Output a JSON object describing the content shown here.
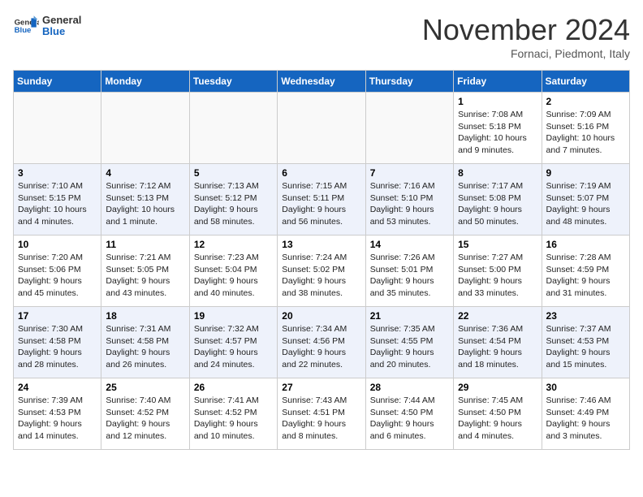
{
  "header": {
    "logo_line1": "General",
    "logo_line2": "Blue",
    "month_title": "November 2024",
    "subtitle": "Fornaci, Piedmont, Italy"
  },
  "weekdays": [
    "Sunday",
    "Monday",
    "Tuesday",
    "Wednesday",
    "Thursday",
    "Friday",
    "Saturday"
  ],
  "weeks": [
    [
      {
        "day": "",
        "info": ""
      },
      {
        "day": "",
        "info": ""
      },
      {
        "day": "",
        "info": ""
      },
      {
        "day": "",
        "info": ""
      },
      {
        "day": "",
        "info": ""
      },
      {
        "day": "1",
        "info": "Sunrise: 7:08 AM\nSunset: 5:18 PM\nDaylight: 10 hours and 9 minutes."
      },
      {
        "day": "2",
        "info": "Sunrise: 7:09 AM\nSunset: 5:16 PM\nDaylight: 10 hours and 7 minutes."
      }
    ],
    [
      {
        "day": "3",
        "info": "Sunrise: 7:10 AM\nSunset: 5:15 PM\nDaylight: 10 hours and 4 minutes."
      },
      {
        "day": "4",
        "info": "Sunrise: 7:12 AM\nSunset: 5:13 PM\nDaylight: 10 hours and 1 minute."
      },
      {
        "day": "5",
        "info": "Sunrise: 7:13 AM\nSunset: 5:12 PM\nDaylight: 9 hours and 58 minutes."
      },
      {
        "day": "6",
        "info": "Sunrise: 7:15 AM\nSunset: 5:11 PM\nDaylight: 9 hours and 56 minutes."
      },
      {
        "day": "7",
        "info": "Sunrise: 7:16 AM\nSunset: 5:10 PM\nDaylight: 9 hours and 53 minutes."
      },
      {
        "day": "8",
        "info": "Sunrise: 7:17 AM\nSunset: 5:08 PM\nDaylight: 9 hours and 50 minutes."
      },
      {
        "day": "9",
        "info": "Sunrise: 7:19 AM\nSunset: 5:07 PM\nDaylight: 9 hours and 48 minutes."
      }
    ],
    [
      {
        "day": "10",
        "info": "Sunrise: 7:20 AM\nSunset: 5:06 PM\nDaylight: 9 hours and 45 minutes."
      },
      {
        "day": "11",
        "info": "Sunrise: 7:21 AM\nSunset: 5:05 PM\nDaylight: 9 hours and 43 minutes."
      },
      {
        "day": "12",
        "info": "Sunrise: 7:23 AM\nSunset: 5:04 PM\nDaylight: 9 hours and 40 minutes."
      },
      {
        "day": "13",
        "info": "Sunrise: 7:24 AM\nSunset: 5:02 PM\nDaylight: 9 hours and 38 minutes."
      },
      {
        "day": "14",
        "info": "Sunrise: 7:26 AM\nSunset: 5:01 PM\nDaylight: 9 hours and 35 minutes."
      },
      {
        "day": "15",
        "info": "Sunrise: 7:27 AM\nSunset: 5:00 PM\nDaylight: 9 hours and 33 minutes."
      },
      {
        "day": "16",
        "info": "Sunrise: 7:28 AM\nSunset: 4:59 PM\nDaylight: 9 hours and 31 minutes."
      }
    ],
    [
      {
        "day": "17",
        "info": "Sunrise: 7:30 AM\nSunset: 4:58 PM\nDaylight: 9 hours and 28 minutes."
      },
      {
        "day": "18",
        "info": "Sunrise: 7:31 AM\nSunset: 4:58 PM\nDaylight: 9 hours and 26 minutes."
      },
      {
        "day": "19",
        "info": "Sunrise: 7:32 AM\nSunset: 4:57 PM\nDaylight: 9 hours and 24 minutes."
      },
      {
        "day": "20",
        "info": "Sunrise: 7:34 AM\nSunset: 4:56 PM\nDaylight: 9 hours and 22 minutes."
      },
      {
        "day": "21",
        "info": "Sunrise: 7:35 AM\nSunset: 4:55 PM\nDaylight: 9 hours and 20 minutes."
      },
      {
        "day": "22",
        "info": "Sunrise: 7:36 AM\nSunset: 4:54 PM\nDaylight: 9 hours and 18 minutes."
      },
      {
        "day": "23",
        "info": "Sunrise: 7:37 AM\nSunset: 4:53 PM\nDaylight: 9 hours and 15 minutes."
      }
    ],
    [
      {
        "day": "24",
        "info": "Sunrise: 7:39 AM\nSunset: 4:53 PM\nDaylight: 9 hours and 14 minutes."
      },
      {
        "day": "25",
        "info": "Sunrise: 7:40 AM\nSunset: 4:52 PM\nDaylight: 9 hours and 12 minutes."
      },
      {
        "day": "26",
        "info": "Sunrise: 7:41 AM\nSunset: 4:52 PM\nDaylight: 9 hours and 10 minutes."
      },
      {
        "day": "27",
        "info": "Sunrise: 7:43 AM\nSunset: 4:51 PM\nDaylight: 9 hours and 8 minutes."
      },
      {
        "day": "28",
        "info": "Sunrise: 7:44 AM\nSunset: 4:50 PM\nDaylight: 9 hours and 6 minutes."
      },
      {
        "day": "29",
        "info": "Sunrise: 7:45 AM\nSunset: 4:50 PM\nDaylight: 9 hours and 4 minutes."
      },
      {
        "day": "30",
        "info": "Sunrise: 7:46 AM\nSunset: 4:49 PM\nDaylight: 9 hours and 3 minutes."
      }
    ]
  ]
}
